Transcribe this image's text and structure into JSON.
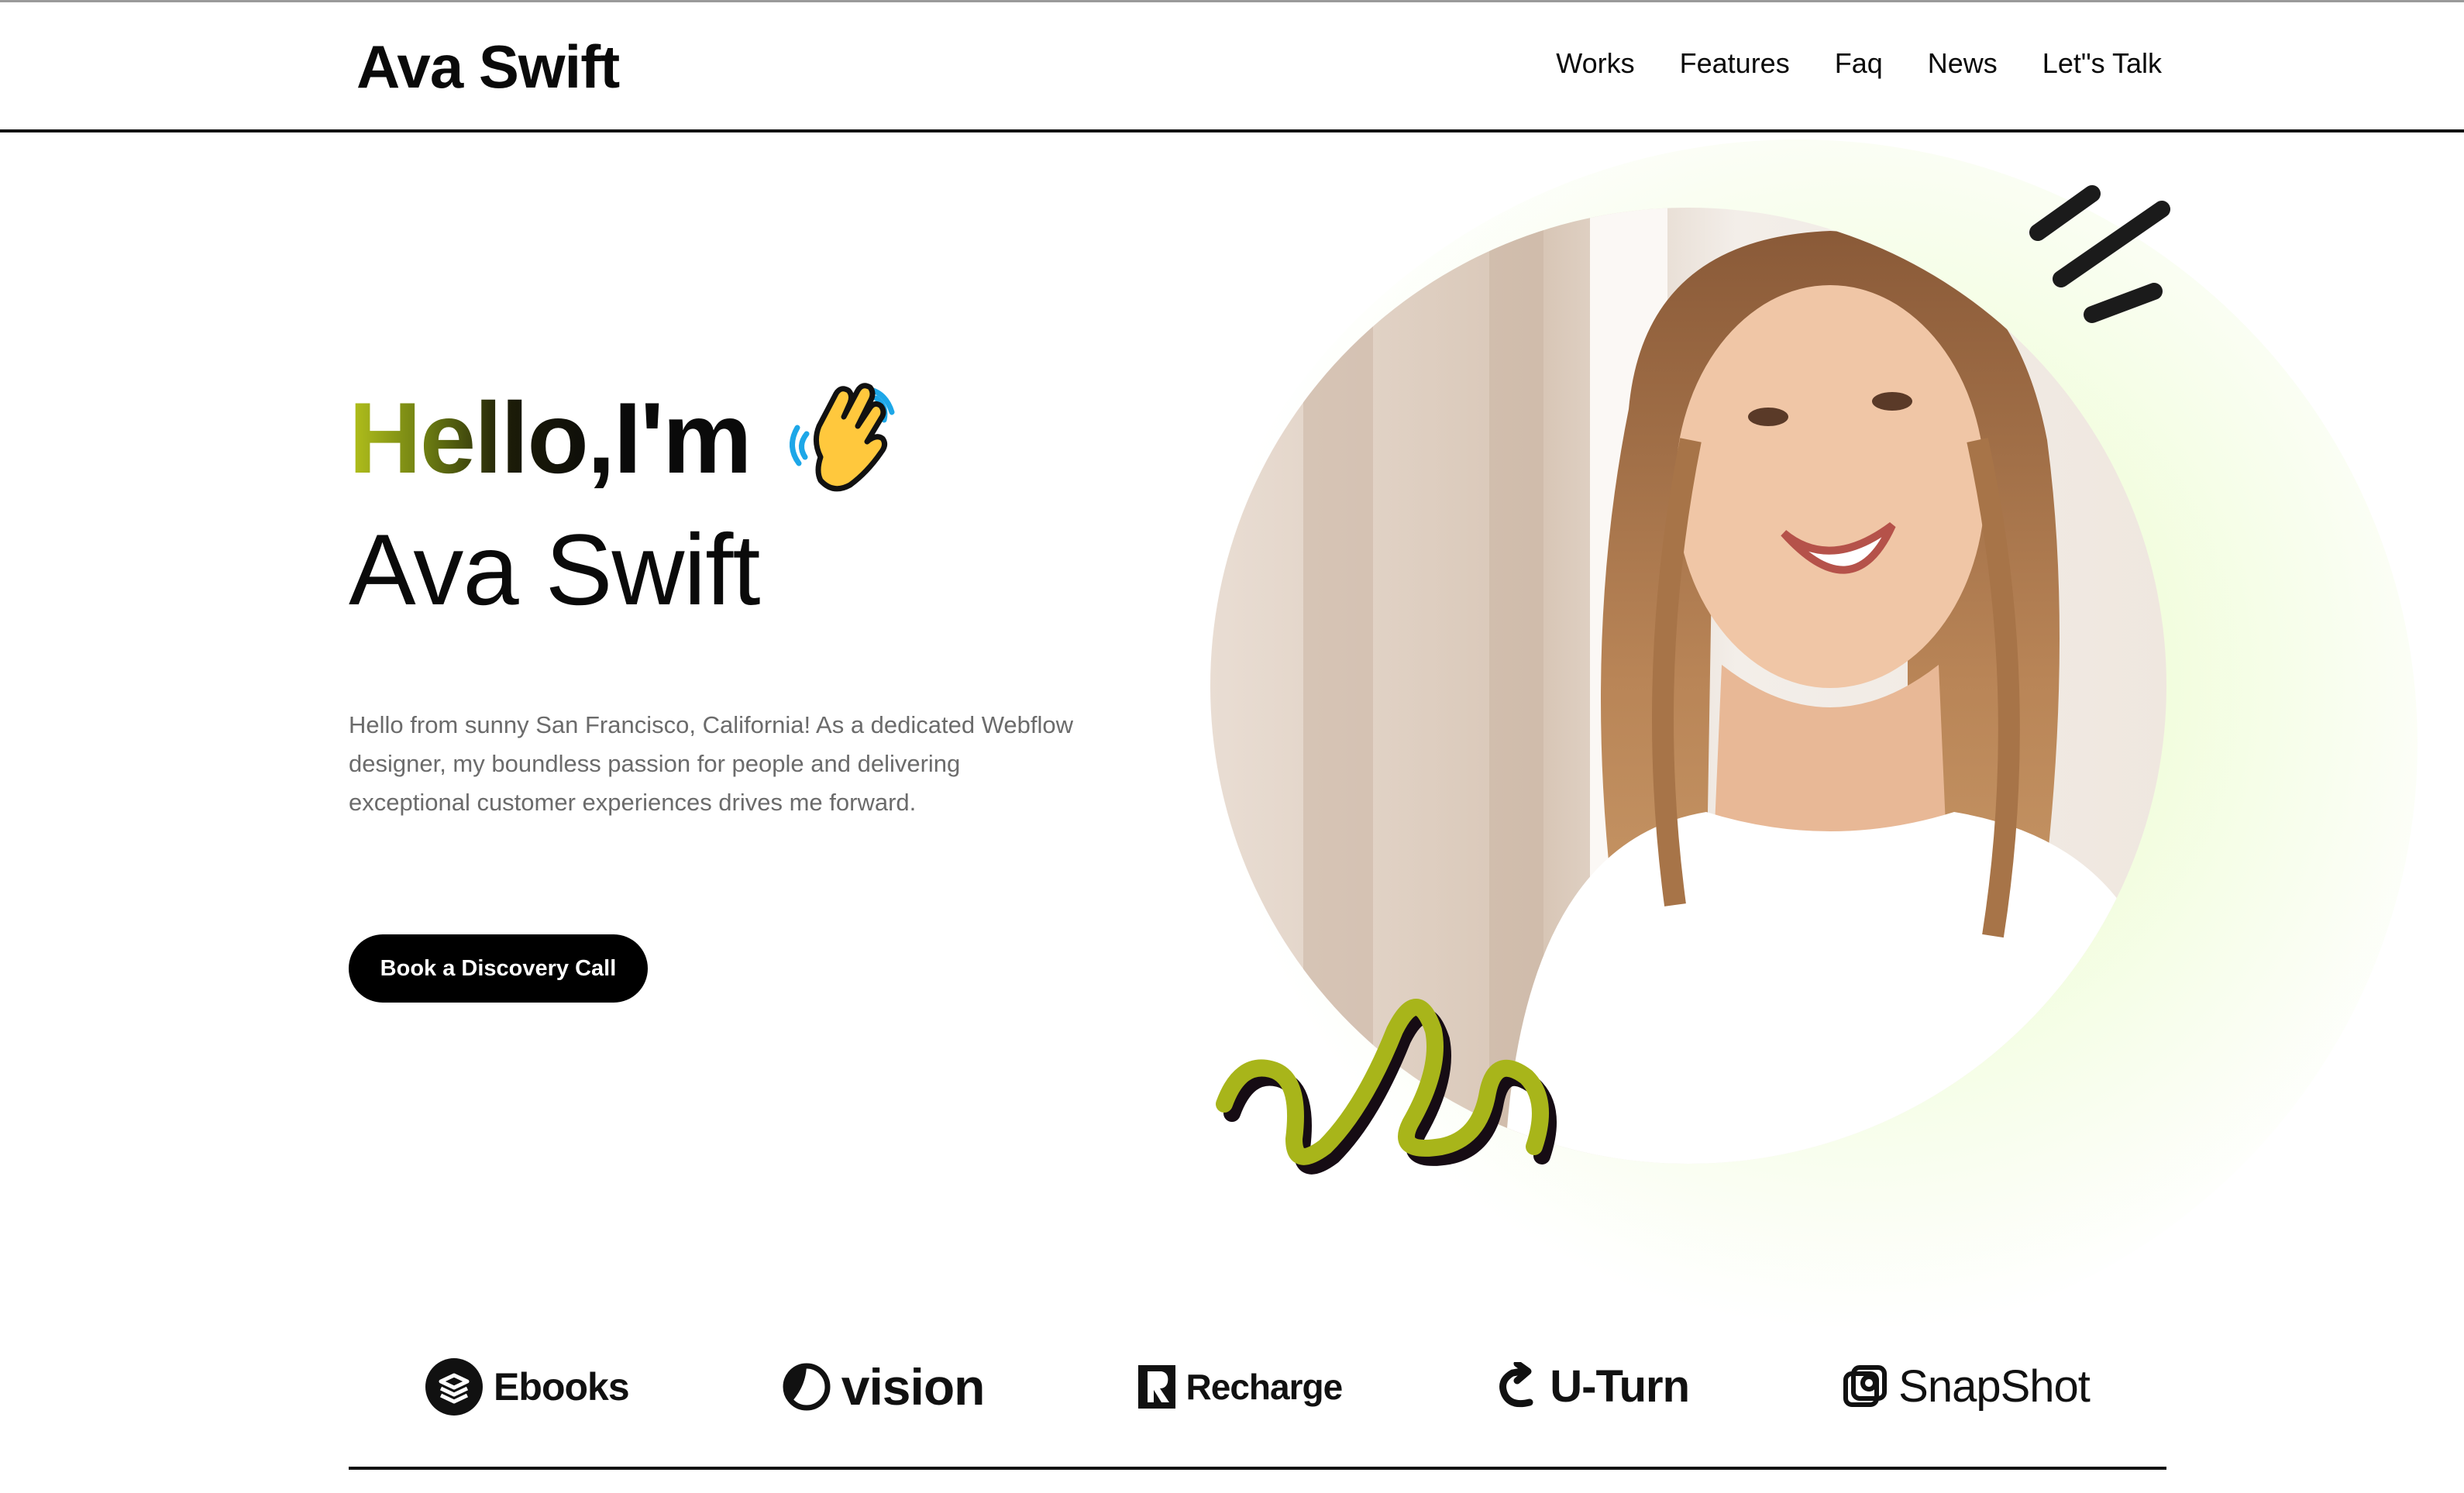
{
  "brand": "Ava Swift",
  "nav": [
    "Works",
    "Features",
    "Faq",
    "News",
    "Let\"s Talk"
  ],
  "hero": {
    "hello": "Hello,",
    "im": "I'm",
    "wave_icon": "waving-hand-emoji",
    "name": "Ava Swift",
    "description": "Hello from sunny San Francisco, California! As a dedicated Webflow designer, my boundless passion for people and delivering exceptional customer experiences drives me forward.",
    "cta": "Book a Discovery Call"
  },
  "logos": [
    "Ebooks",
    "vision",
    "Recharge",
    "U-Turn",
    "SnapShot"
  ],
  "colors": {
    "accent": "#a8b51a",
    "dark": "#0a0a0a",
    "glow": "#e6fbc4",
    "text_muted": "#6b6b6b"
  }
}
